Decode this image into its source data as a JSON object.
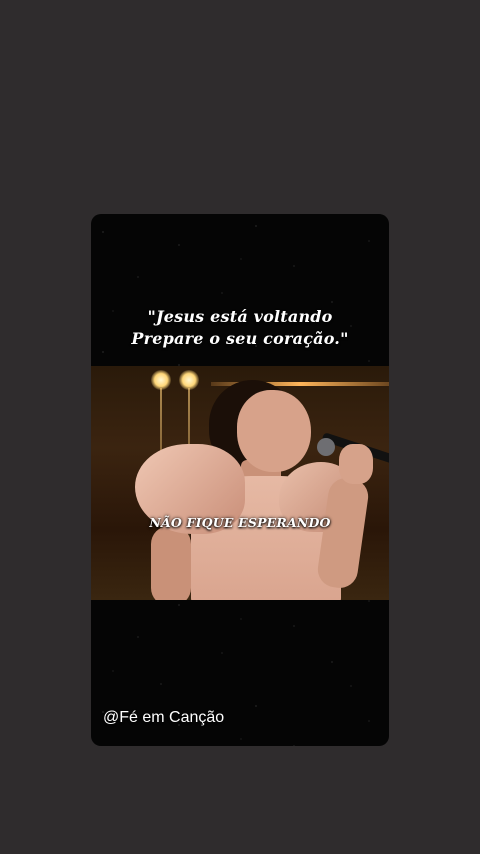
{
  "post": {
    "quote_line1": "\"Jesus está voltando",
    "quote_line2": "Prepare o seu coração.\"",
    "video": {
      "subtitle": "NÃO FIQUE ESPERANDO"
    },
    "handle": "@Fé em Canção"
  },
  "colors": {
    "page_background": "#2f2c2d",
    "card_background": "#050505",
    "text": "#ffffff"
  },
  "icons": {
    "stars_background": "starfield"
  }
}
